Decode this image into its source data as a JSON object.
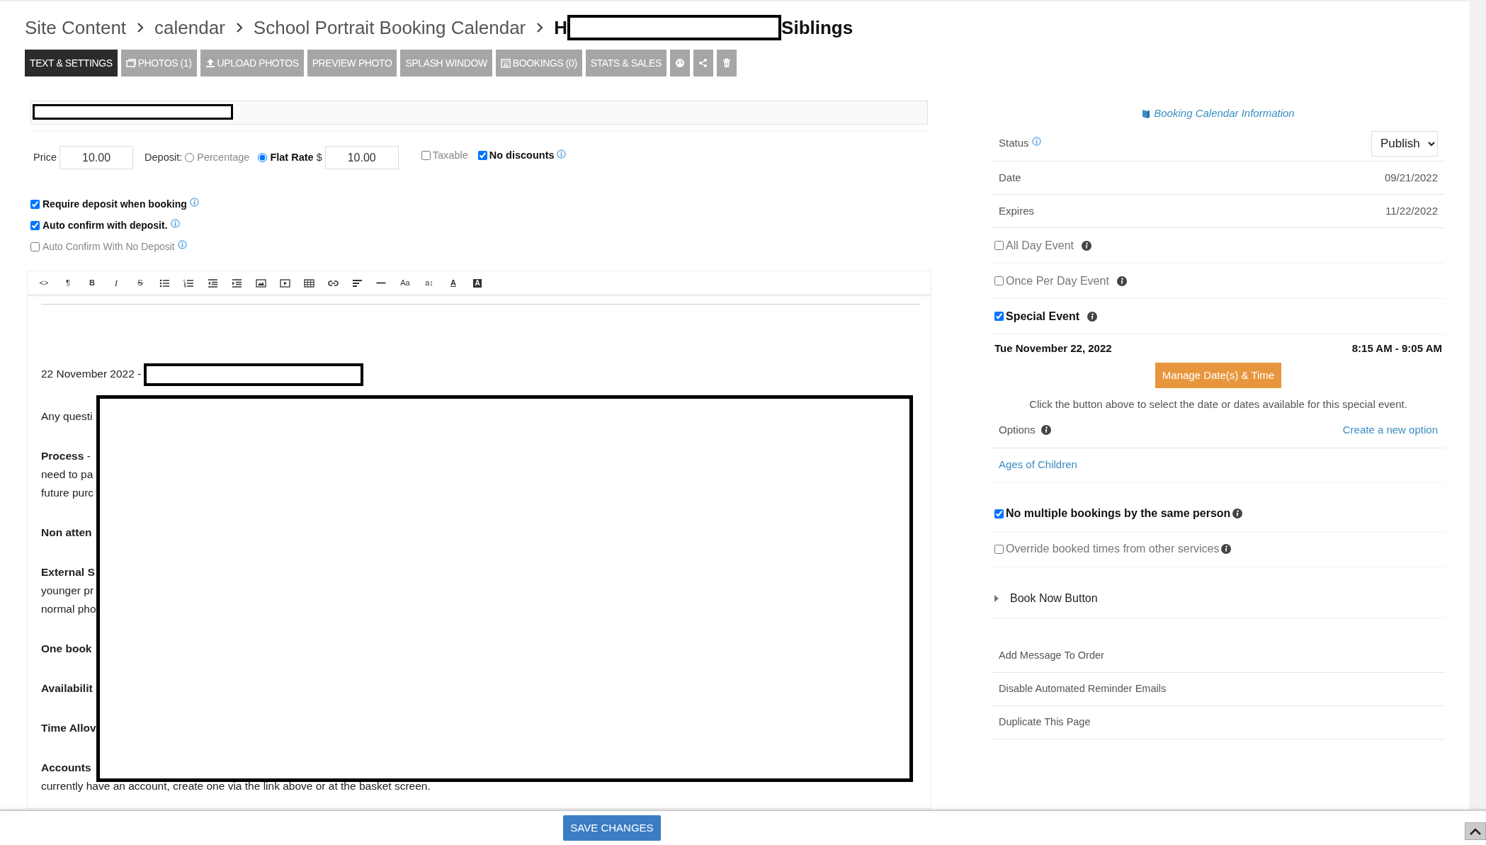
{
  "breadcrumb": [
    {
      "label": "Site Content"
    },
    {
      "label": "calendar"
    },
    {
      "label": "School Portrait Booking Calendar"
    }
  ],
  "title_parts": [
    "H",
    "Siblings"
  ],
  "tabs": [
    {
      "label": "TEXT & SETTINGS",
      "selected": true
    },
    {
      "label": "PHOTOS (1)",
      "selected": false
    },
    {
      "label": "UPLOAD PHOTOS",
      "selected": false
    },
    {
      "label": "PREVIEW PHOTO",
      "selected": false
    },
    {
      "label": "SPLASH WINDOW",
      "selected": false
    },
    {
      "label": "BOOKINGS (0)",
      "selected": false
    },
    {
      "label": "STATS & SALES",
      "selected": false
    },
    {
      "selected": false
    },
    {
      "selected": false
    },
    {
      "selected": false
    }
  ],
  "pricing": {
    "price_label": "Price",
    "price": "10.00",
    "deposit_label": "Deposit:",
    "deposit_options": [
      {
        "label": "Percentage",
        "selected": false
      },
      {
        "label": "Flat Rate",
        "selected": true
      }
    ],
    "currency": "$",
    "deposit_amount": "10.00",
    "flags": [
      {
        "label": "Taxable",
        "checked": false
      },
      {
        "label": "No discounts",
        "checked": true
      }
    ]
  },
  "booking_options": [
    {
      "label": "Require deposit when booking",
      "checked": true
    },
    {
      "label": "Auto confirm with deposit.",
      "checked": true
    },
    {
      "label": "Auto Confirm With No Deposit",
      "checked": false
    }
  ],
  "editor": {
    "toolbar": [
      {
        "kind": "text",
        "glyph": "<>"
      },
      {
        "kind": "text",
        "glyph": "¶"
      },
      {
        "kind": "bold",
        "glyph": "B"
      },
      {
        "kind": "italic",
        "glyph": "I"
      },
      {
        "kind": "strike",
        "glyph": "S"
      },
      {
        "kind": "ul"
      },
      {
        "kind": "ol"
      },
      {
        "kind": "outdent"
      },
      {
        "kind": "indent"
      },
      {
        "kind": "image"
      },
      {
        "kind": "video"
      },
      {
        "kind": "table"
      },
      {
        "kind": "link"
      },
      {
        "kind": "align"
      },
      {
        "kind": "hr"
      },
      {
        "kind": "text",
        "glyph": "Aa"
      },
      {
        "kind": "text",
        "glyph": "a↕"
      },
      {
        "kind": "underline",
        "glyph": "A"
      },
      {
        "kind": "inverse",
        "glyph": "A"
      }
    ],
    "paragraphs": [
      {
        "lines": [
          {
            "text": "22 November 2022 -",
            "bold": false
          }
        ]
      },
      {
        "lines": [
          {
            "text": "Any questi",
            "bold": false
          }
        ]
      },
      {
        "lines": [
          {
            "text": "**Process** -",
            "bold": false
          },
          {
            "text": "need to pa",
            "bold": false
          },
          {
            "text": "future purc",
            "bold": false
          }
        ]
      },
      {
        "lines": [
          {
            "text": "Non atten",
            "bold": true
          }
        ]
      },
      {
        "lines": [
          {
            "text": "External S",
            "bold": true
          },
          {
            "text": "younger pr",
            "bold": false
          },
          {
            "text": "normal pho",
            "bold": false
          }
        ]
      },
      {
        "lines": [
          {
            "text": "One book",
            "bold": true
          }
        ]
      },
      {
        "lines": [
          {
            "text": "Availabilit",
            "bold": true
          }
        ]
      },
      {
        "lines": [
          {
            "text": "Time Allov",
            "bold": true
          }
        ]
      },
      {
        "lines": [
          {
            "text": "Accounts",
            "bold": true
          },
          {
            "text": "currently have an account, create one via the link above or at the basket screen.",
            "bold": false
          }
        ]
      }
    ]
  },
  "info_link": "Booking Calendar Information",
  "status": {
    "label": "Status",
    "value": "Publish"
  },
  "fields": [
    {
      "label": "Date",
      "value": "09/21/2022"
    },
    {
      "label": "Expires",
      "value": "11/22/2022"
    }
  ],
  "event_types": [
    {
      "label": "All Day Event",
      "checked": false
    },
    {
      "label": "Once Per Day Event",
      "checked": false
    },
    {
      "label": "Special Event",
      "checked": true
    }
  ],
  "schedule": {
    "date": "Tue November 22, 2022",
    "time": "8:15 AM - 9:05 AM"
  },
  "manage_button": "Manage Date(s) & Time",
  "hint": "Click the button above to select the date or dates available for this special event.",
  "options": {
    "label": "Options",
    "link": "Create a new option"
  },
  "option_items": [
    "Ages of Children"
  ],
  "restrictions": [
    {
      "label": "No multiple bookings by the same person",
      "checked": true
    },
    {
      "label": "Override booked times from other services",
      "checked": false
    }
  ],
  "book_now": {
    "label": "Book Now Button",
    "expanded": false
  },
  "actions": [
    "Add Message To Order",
    "Disable Automated Reminder Emails",
    "Duplicate This Page"
  ],
  "save_button": "SAVE CHANGES"
}
